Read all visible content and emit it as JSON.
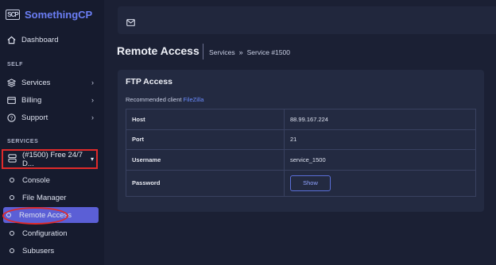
{
  "brand": {
    "logo_text": "SCP",
    "name": "SomethingCP"
  },
  "sidebar": {
    "dashboard": "Dashboard",
    "self_section": "SELF",
    "self_items": [
      {
        "label": "Services",
        "icon": "layers-icon"
      },
      {
        "label": "Billing",
        "icon": "card-icon"
      },
      {
        "label": "Support",
        "icon": "help-icon"
      }
    ],
    "services_section": "SERVICES",
    "service_select": "(#1500) Free 24/7 D...",
    "service_items": [
      "Console",
      "File Manager",
      "Remote Access",
      "Configuration",
      "Subusers"
    ]
  },
  "header": {
    "title": "Remote Access",
    "breadcrumb": [
      "Services",
      "Service #1500"
    ],
    "breadcrumb_sep": "»"
  },
  "card": {
    "title": "FTP Access",
    "recommend_prefix": "Recommended client",
    "recommend_link": "FileZilla",
    "rows": [
      {
        "key": "Host",
        "value": "88.99.167.224"
      },
      {
        "key": "Port",
        "value": "21"
      },
      {
        "key": "Username",
        "value": "service_1500"
      },
      {
        "key": "Password",
        "button": "Show"
      }
    ]
  },
  "colors": {
    "accent": "#5b5fd6",
    "highlight": "#e02a2a",
    "brand": "#6b7ef5"
  }
}
